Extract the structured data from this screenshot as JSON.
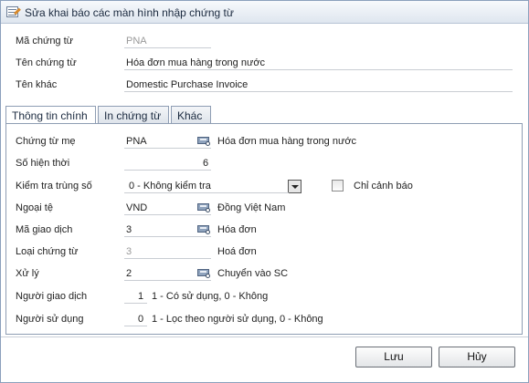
{
  "window": {
    "title": "Sửa khai báo các màn hình nhập chứng từ"
  },
  "header": {
    "code_label": "Mã chứng từ",
    "code_value": "PNA",
    "name_label": "Tên chứng từ",
    "name_value": "Hóa đơn mua hàng trong nước",
    "other_label": "Tên khác",
    "other_value": "Domestic Purchase Invoice"
  },
  "tabs": [
    {
      "label": "Thông tin chính",
      "active": true
    },
    {
      "label": "In chứng từ",
      "active": false
    },
    {
      "label": "Khác",
      "active": false
    }
  ],
  "main": {
    "parent_doc_label": "Chứng từ mẹ",
    "parent_doc_code": "PNA",
    "parent_doc_name": "Hóa đơn mua hàng trong nước",
    "current_no_label": "Số hiện thời",
    "current_no_value": "6",
    "dup_check_label": "Kiểm tra trùng số",
    "dup_check_value": "0 - Không kiểm tra",
    "warn_only_label": "Chỉ cảnh báo",
    "warn_only_checked": false,
    "currency_label": "Ngoại tệ",
    "currency_code": "VND",
    "currency_name": "Đồng Việt Nam",
    "trans_code_label": "Mã giao dịch",
    "trans_code_value": "3",
    "trans_code_name": "Hóa đơn",
    "doc_type_label": "Loại chứng từ",
    "doc_type_value": "3",
    "doc_type_name": "Hoá đơn",
    "process_label": "Xử lý",
    "process_value": "2",
    "process_name": "Chuyển vào SC",
    "deliverer_label": "Người giao dịch",
    "deliverer_value": "1",
    "deliverer_note": "1 - Có sử dụng, 0 - Không",
    "user_label": "Người sử dụng",
    "user_value": "0",
    "user_note": "1 - Lọc theo người sử dụng, 0 - Không"
  },
  "footer": {
    "save_label": "Lưu",
    "cancel_label": "Hủy"
  }
}
